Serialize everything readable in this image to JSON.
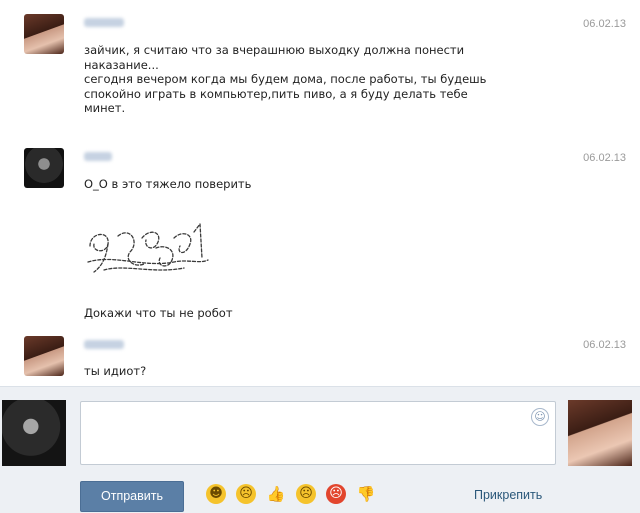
{
  "messages": [
    {
      "date": "06.02.13",
      "lines": [
        "зайчик, я считаю что за вчерашнюю выходку должна понести",
        "наказание...",
        "сегодня вечером когда мы будем дома, после работы, ты будешь",
        "спокойно играть в компьютер,пить пиво, а я буду делать тебе",
        "минет."
      ]
    },
    {
      "date": "06.02.13",
      "text": "О_О в это тяжело поверить",
      "robot_text": "Докажи что ты не робот"
    },
    {
      "date": "06.02.13",
      "text": "ты идиот?"
    }
  ],
  "composer": {
    "send_label": "Отправить",
    "attach_label": "Прикрепить",
    "emoji_icons": [
      "smile-icon",
      "neutral-face-icon",
      "thumbs-up-icon",
      "scared-face-icon",
      "angry-face-icon",
      "thumbs-down-icon"
    ]
  }
}
